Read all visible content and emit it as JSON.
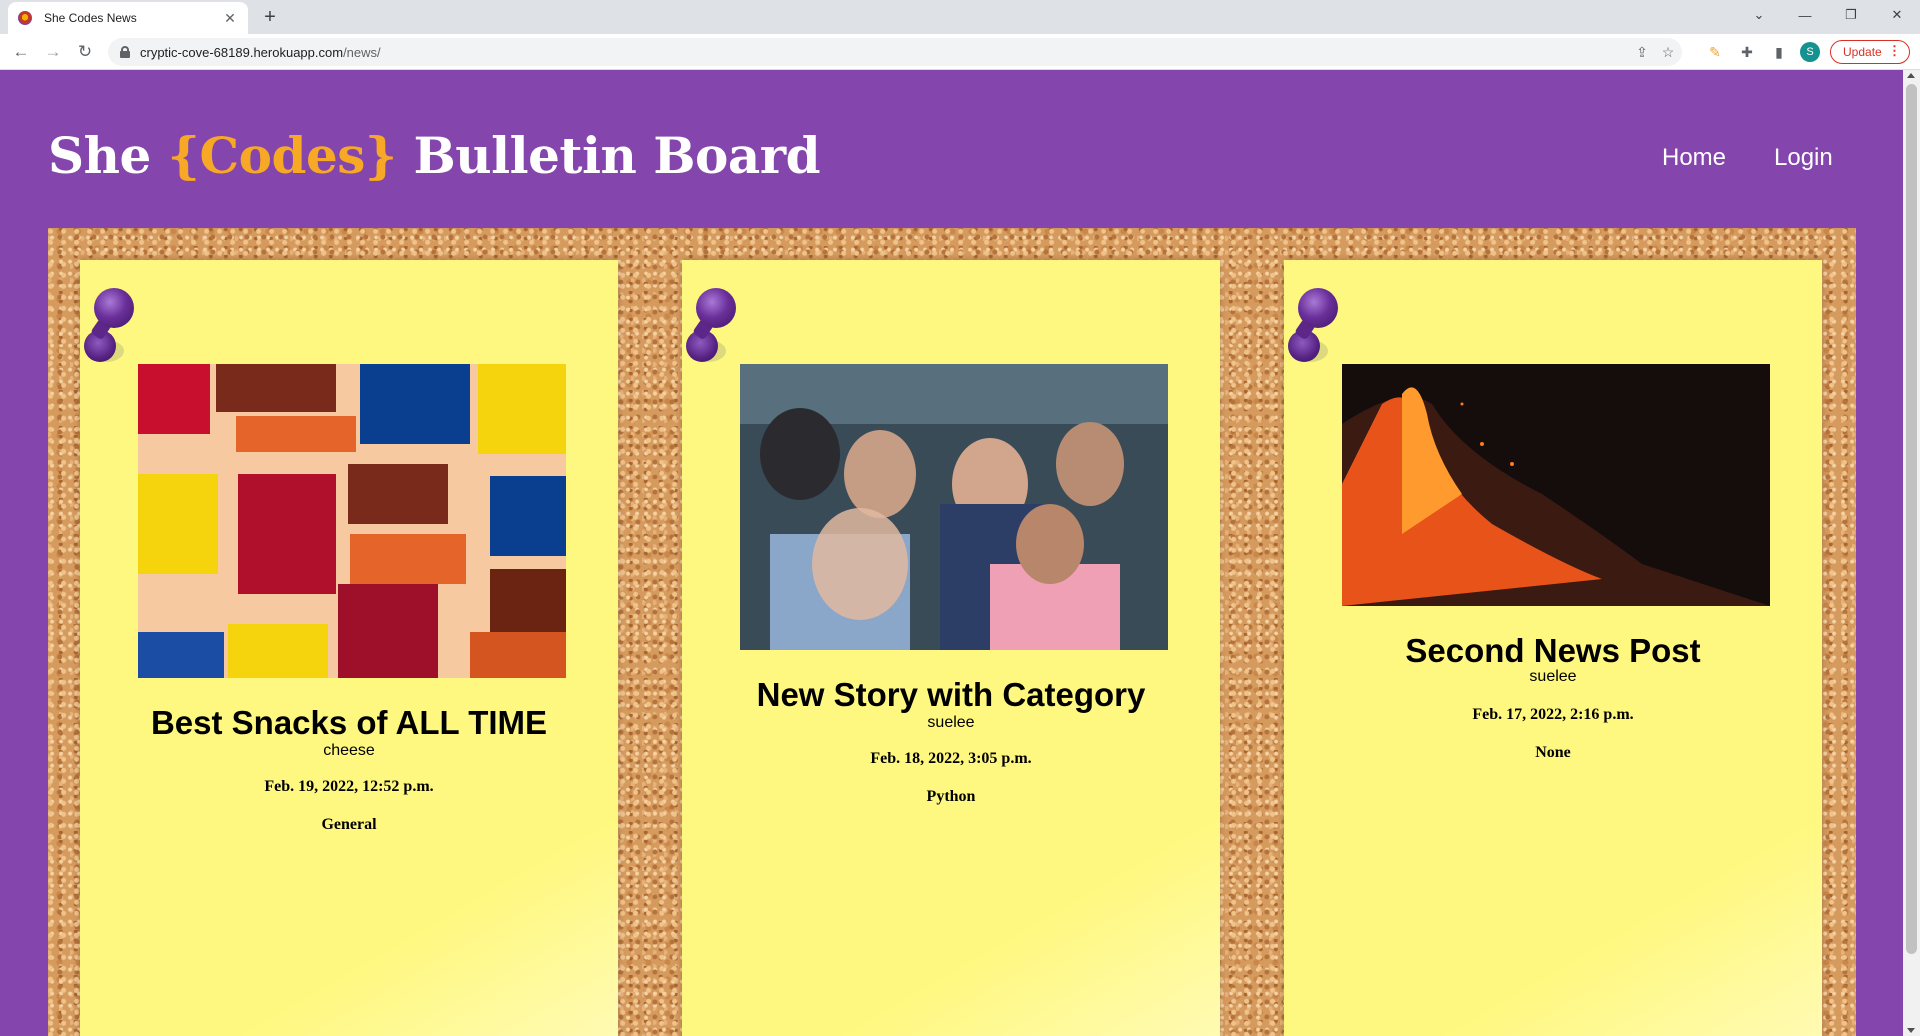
{
  "browser": {
    "tab_title": "She Codes News",
    "tab_close": "✕",
    "new_tab": "+",
    "url_host": "cryptic-cove-68189.herokuapp.com",
    "url_path": "/news/",
    "profile_initial": "S",
    "update_label": "Update",
    "update_menu": "⋮"
  },
  "site": {
    "title_before": "She ",
    "title_accent": "{Codes}",
    "title_after": " Bulletin Board",
    "accent_color": "#f7a825",
    "header_bg": "#8446ad",
    "nav": {
      "home": "Home",
      "login": "Login"
    }
  },
  "posts": [
    {
      "title": "Best Snacks of ALL TIME",
      "author": "cheese",
      "date": "Feb. 19, 2022, 12:52 p.m.",
      "category": "General",
      "image": "snack-bags"
    },
    {
      "title": "New Story with Category",
      "author": "suelee",
      "date": "Feb. 18, 2022, 3:05 p.m.",
      "category": "Python",
      "image": "audience-crowd"
    },
    {
      "title": "Second News Post",
      "author": "suelee",
      "date": "Feb. 17, 2022, 2:16 p.m.",
      "category": "None",
      "image": "volcano-eruption"
    }
  ]
}
